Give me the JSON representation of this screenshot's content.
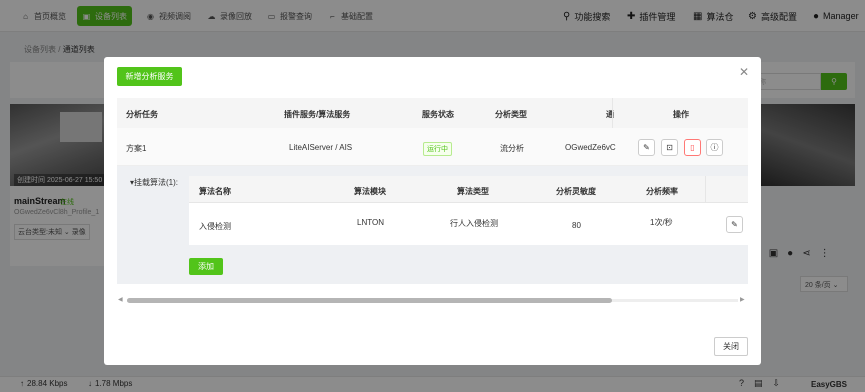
{
  "nav": {
    "items": [
      {
        "label": "首页概览",
        "icon": "home-icon"
      },
      {
        "label": "设备列表",
        "icon": "device-icon",
        "active": true
      },
      {
        "label": "视频调阅",
        "icon": "video-icon"
      },
      {
        "label": "录像回放",
        "icon": "cloud-icon"
      },
      {
        "label": "报警查询",
        "icon": "alarm-icon"
      },
      {
        "label": "基础配置",
        "icon": "config-icon"
      }
    ],
    "right": [
      {
        "label": "功能搜索",
        "icon": "search-icon"
      },
      {
        "label": "插件管理",
        "icon": "puzzle-icon"
      },
      {
        "label": "算法仓",
        "icon": "store-icon"
      },
      {
        "label": "高级配置",
        "icon": "gear-icon"
      },
      {
        "label": "Manager",
        "icon": "user-icon"
      }
    ]
  },
  "breadcrumb": {
    "parent": "设备列表",
    "separator": "/",
    "current": "通道列表"
  },
  "background": {
    "search_placeholder": "名称",
    "cam_timestamp": "创建时间 2025-06-27 15:50",
    "stream_name": "mainStream",
    "stream_status": "在线",
    "stream_id": "OGwedZe6vCl8h_Profile_1",
    "ptz_label": "云台类型:未知",
    "ptz_extra": "录像",
    "page_size": "20 条/页",
    "upload_speed": "28.84 Kbps",
    "download_speed": "1.78 Mbps",
    "brand": "EasyGBS"
  },
  "modal": {
    "add_service_label": "新增分析服务",
    "close_label": "关闭",
    "columns": [
      "分析任务",
      "插件服务/算法服务",
      "服务状态",
      "分析类型",
      "通",
      "操作"
    ],
    "row": {
      "task": "方案1",
      "service": "LiteAIServer / AIS",
      "status": "运行中",
      "type": "流分析",
      "channel": "OGwedZe6vC"
    },
    "sub": {
      "label": "挂载算法(1):",
      "columns": [
        "算法名称",
        "算法模块",
        "算法类型",
        "分析灵敏度",
        "分析频率"
      ],
      "row": {
        "name": "入侵检测",
        "module": "LNTON",
        "type": "行人入侵检测",
        "sensitivity": "80",
        "frequency": "1次/秒"
      },
      "add_label": "添加"
    }
  },
  "colors": {
    "accent": "#52c41a",
    "danger": "#ff4d4f"
  }
}
